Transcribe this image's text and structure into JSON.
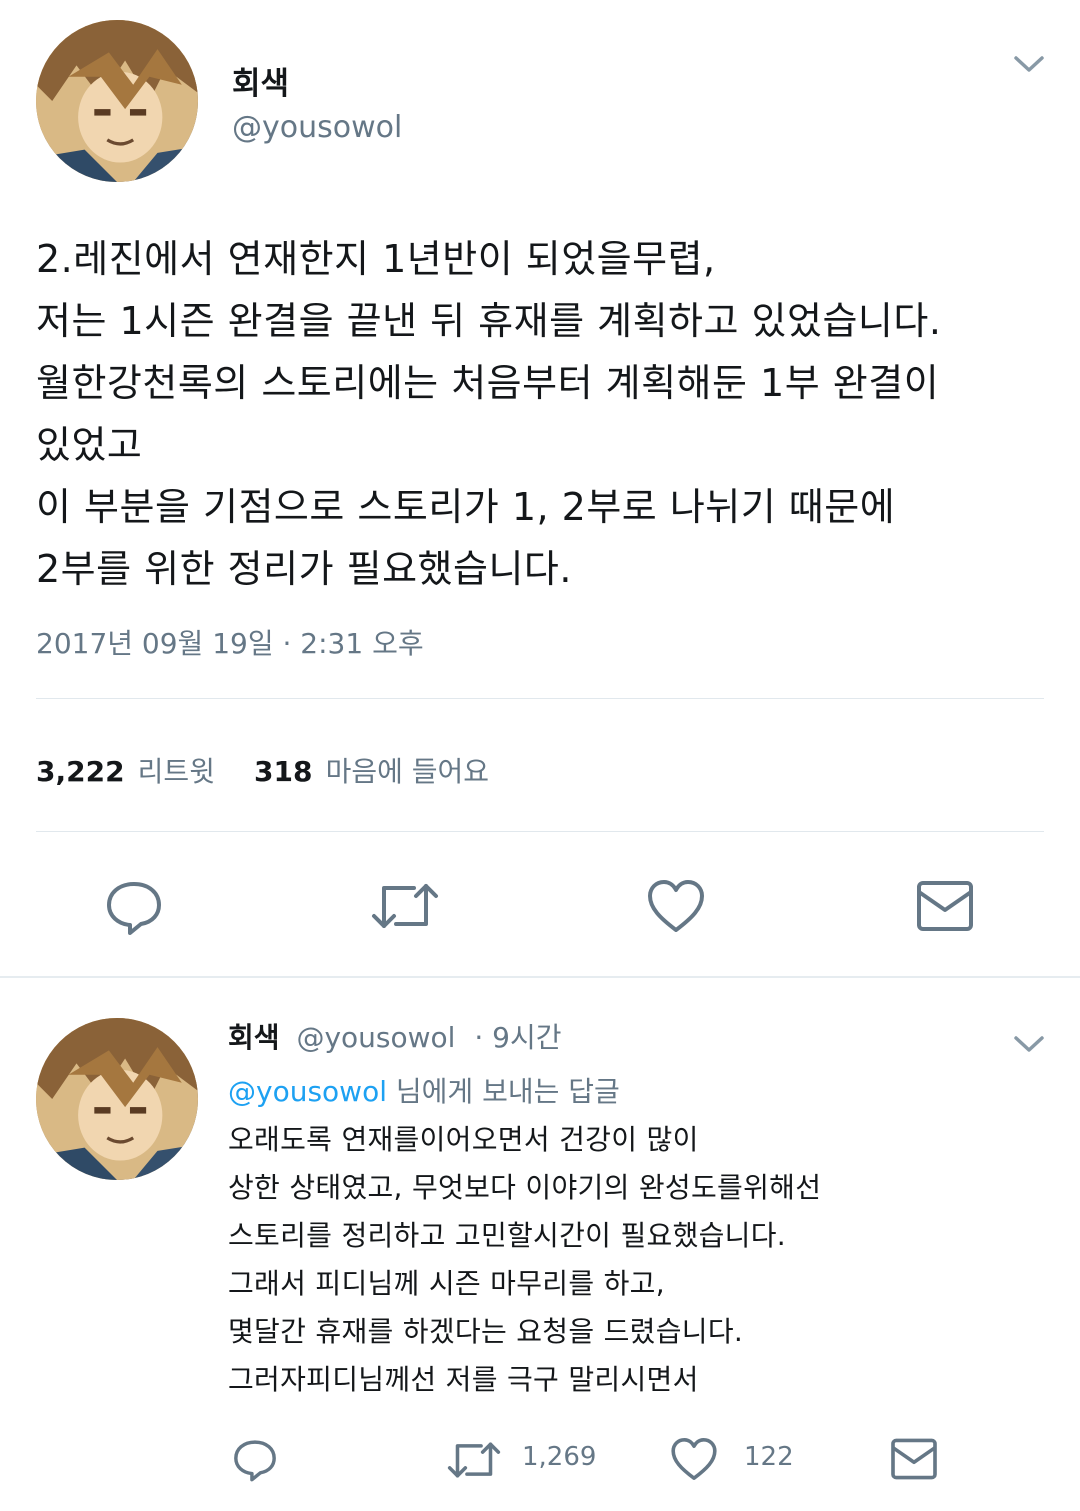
{
  "tweet": {
    "name": "회색",
    "handle": "@yousowol",
    "text": "2.레진에서 연재한지 1년반이 되었을무렵,\n저는 1시즌 완결을 끝낸 뒤 휴재를 계획하고 있었습니다.\n월한강천록의 스토리에는 처음부터 계획해둔 1부 완결이\n있었고\n이 부분을 기점으로 스토리가 1, 2부로 나뉘기 때문에\n2부를 위한 정리가 필요했습니다.",
    "timestamp": "2017년 09월 19일 · 2:31 오후",
    "retweets_count": "3,222",
    "retweets_label": "리트윗",
    "likes_count": "318",
    "likes_label": "마음에 들어요"
  },
  "reply": {
    "name": "회색",
    "handle": "@yousowol",
    "time": "· 9시간",
    "reply_to_handle": "@yousowol",
    "reply_to_suffix": " 님에게 보내는 답글",
    "text": "오래도록 연재를이어오면서 건강이 많이\n상한 상태였고, 무엇보다 이야기의 완성도를위해선\n스토리를 정리하고 고민할시간이 필요했습니다.\n그래서 피디님께 시즌 마무리를 하고,\n몇달간 휴재를 하겠다는 요청을 드렸습니다.\n그러자피디님께선 저를 극구 말리시면서",
    "retweets_count": "1,269",
    "likes_count": "122"
  },
  "colors": {
    "text": "#14171a",
    "muted": "#657786",
    "link": "#1da1f2",
    "divider": "#e1e8ed"
  },
  "icons": [
    "chevron-down-icon",
    "reply-icon",
    "retweet-icon",
    "heart-icon",
    "mail-icon"
  ]
}
